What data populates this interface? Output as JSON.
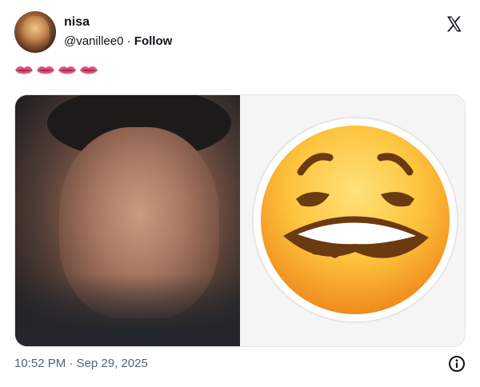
{
  "tweet": {
    "display_name": "nisa",
    "handle": "@vanillee0",
    "separator": "·",
    "follow_label": "Follow",
    "emoji_text": "👄👄👄👄",
    "timestamp": "10:52 PM · Sep 29, 2025"
  },
  "icons": {
    "logo": "x-logo-icon",
    "info": "info-icon",
    "lips": "lips-emoji-icon"
  },
  "colors": {
    "text_primary": "#0f1419",
    "text_secondary": "#536471",
    "lips_pink": "#e2557f"
  }
}
